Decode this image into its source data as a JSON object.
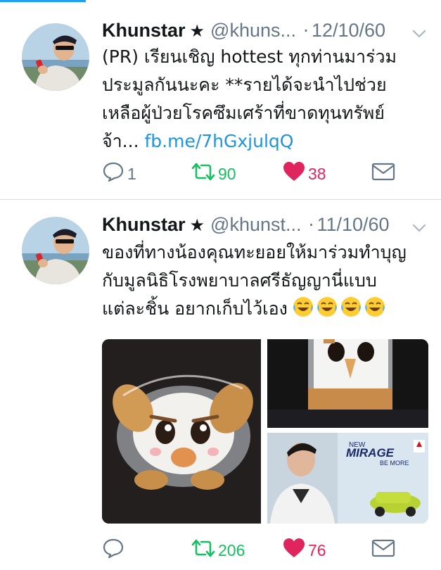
{
  "colors": {
    "accent": "#1da1f2",
    "link": "#1b95e0",
    "retweet": "#17bf63",
    "like": "#e0245e",
    "muted": "#657786",
    "divider": "#d9dee2"
  },
  "tweets": [
    {
      "name": "Khunstar",
      "star": "★",
      "handle": "@khuns...",
      "dot": "·",
      "date": "12/10/60",
      "text": "(PR) เรียนเชิญ hottest ทุกท่านมาร่วม\nประมูลกันนะคะ **รายได้จะนำไปช่วย\nเหลือผู้ป่วยโรคซึมเศร้าที่ขาดทุนทรัพย์\nจ้า... ",
      "link": "fb.me/7hGxjulqQ",
      "replies": "1",
      "retweets": "90",
      "likes": "38",
      "icons": [
        "reply-icon",
        "retweet-icon",
        "heart-icon",
        "mail-icon",
        "chevron-down-icon"
      ]
    },
    {
      "name": "Khunstar",
      "star": "★",
      "handle": "@khunst...",
      "dot": "·",
      "date": "11/10/60",
      "text": "ของที่ทางน้องคุณทะยอยให้มาร่วมทำบุญ\nกับมูลนิธิโรงพยาบาลศรีธัญญานี่แบบ\nแต่ละชิ้น อยากเก็บไว้เอง",
      "emoji": [
        "face-with-tears-of-joy",
        "face-with-tears-of-joy",
        "face-with-tears-of-joy",
        "face-with-tears-of-joy"
      ],
      "replies": "",
      "retweets": "206",
      "likes": "76",
      "media": {
        "product_text": "MIRAGE",
        "product_sub": "BE MORE",
        "new_label": "NEW"
      }
    }
  ]
}
